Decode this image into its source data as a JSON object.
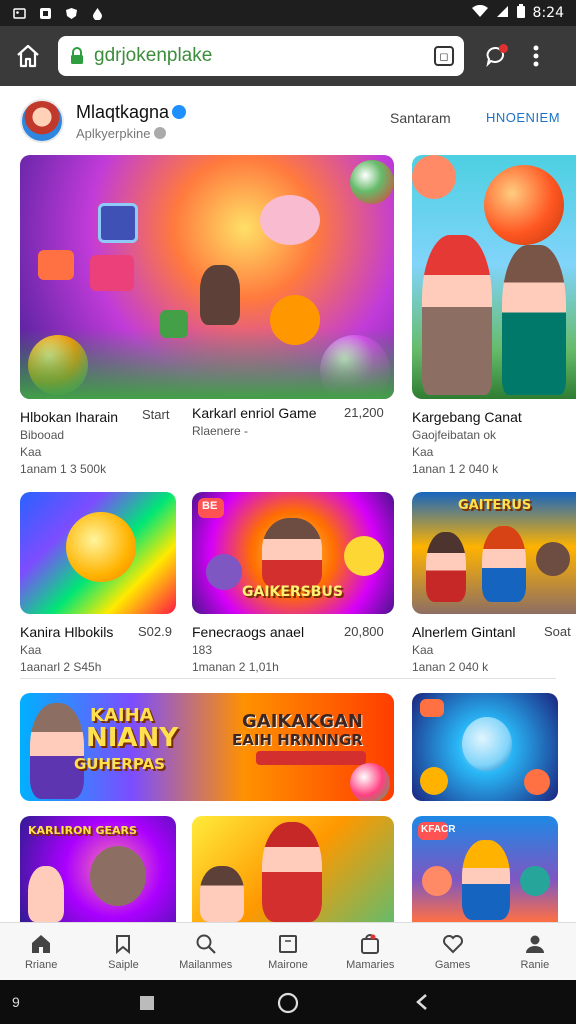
{
  "status_bar": {
    "time": "8:24",
    "left_icons": [
      "image-icon",
      "notification-icon",
      "shield-icon",
      "drop-icon"
    ],
    "right_icons": [
      "wifi-icon",
      "signal-icon",
      "battery-icon"
    ]
  },
  "browser": {
    "url": "gdrjokenplake"
  },
  "profile": {
    "name": "Mlaqtkagna",
    "subtitle": "Aplkyerpkine",
    "link1": "Santaram",
    "link2": "HNOENIEM"
  },
  "row1": [
    {
      "title": "Hlbokan Iharain",
      "right": "Start",
      "line1": "Bibooad",
      "line2": "Kaa",
      "line3": "1anam 1 3 500k"
    },
    {
      "title": "Karkarl enriol Game",
      "right": "21,200",
      "line1": "Rlaenere -",
      "line2": "",
      "line3": ""
    },
    {
      "title": "Kargebang Canat",
      "right": "",
      "line1": "Gaojfeibatan ok",
      "line2": "Kaa",
      "line3": "1anan 1 2 040 k"
    }
  ],
  "row2": [
    {
      "title": "Kanira Hlbokils",
      "right": "S02.9",
      "line1": "Kaa",
      "line3": "1aanarl 2 S45h"
    },
    {
      "title": "Fenecraogs anael",
      "right": "20,800",
      "line1": "183",
      "line3": "1manan 2 1,01h"
    },
    {
      "title": "Alnerlem Gintanl",
      "right": "Soat",
      "line1": "Kaa",
      "line3": "1anan 2 040 k"
    }
  ],
  "banners": {
    "left_title_1": "KAIHA",
    "left_title_2": "NIANY",
    "left_title_3": "GUHERPAS",
    "right_title_1": "GAIKAKGAN",
    "right_title_2": "EAIH HRNNNGR",
    "thumb_b_caption": "BE",
    "thumb_c_caption": "GAIKERSBUS",
    "thumb_d_caption": "GAITERUS",
    "thumb_e_caption": "KARLIRON GEARS",
    "thumb_f_caption": "KFACR"
  },
  "bottom_nav": [
    {
      "label": "Rriane",
      "icon": "home-icon"
    },
    {
      "label": "Saiple",
      "icon": "bookmark-icon"
    },
    {
      "label": "Mailanmes",
      "icon": "search-icon"
    },
    {
      "label": "Mairone",
      "icon": "book-icon"
    },
    {
      "label": "Mamaries",
      "icon": "bag-icon"
    },
    {
      "label": "Games",
      "icon": "heart-icon"
    },
    {
      "label": "Ranie",
      "icon": "person-icon"
    }
  ],
  "system_nav": {
    "left_label": "9"
  },
  "colors": {
    "status_bg": "#1e1e1e",
    "browser_bg": "#3a3a3a",
    "url_green": "#3c8d3c",
    "link_blue": "#1a73c9",
    "badge_red": "#e03131"
  }
}
